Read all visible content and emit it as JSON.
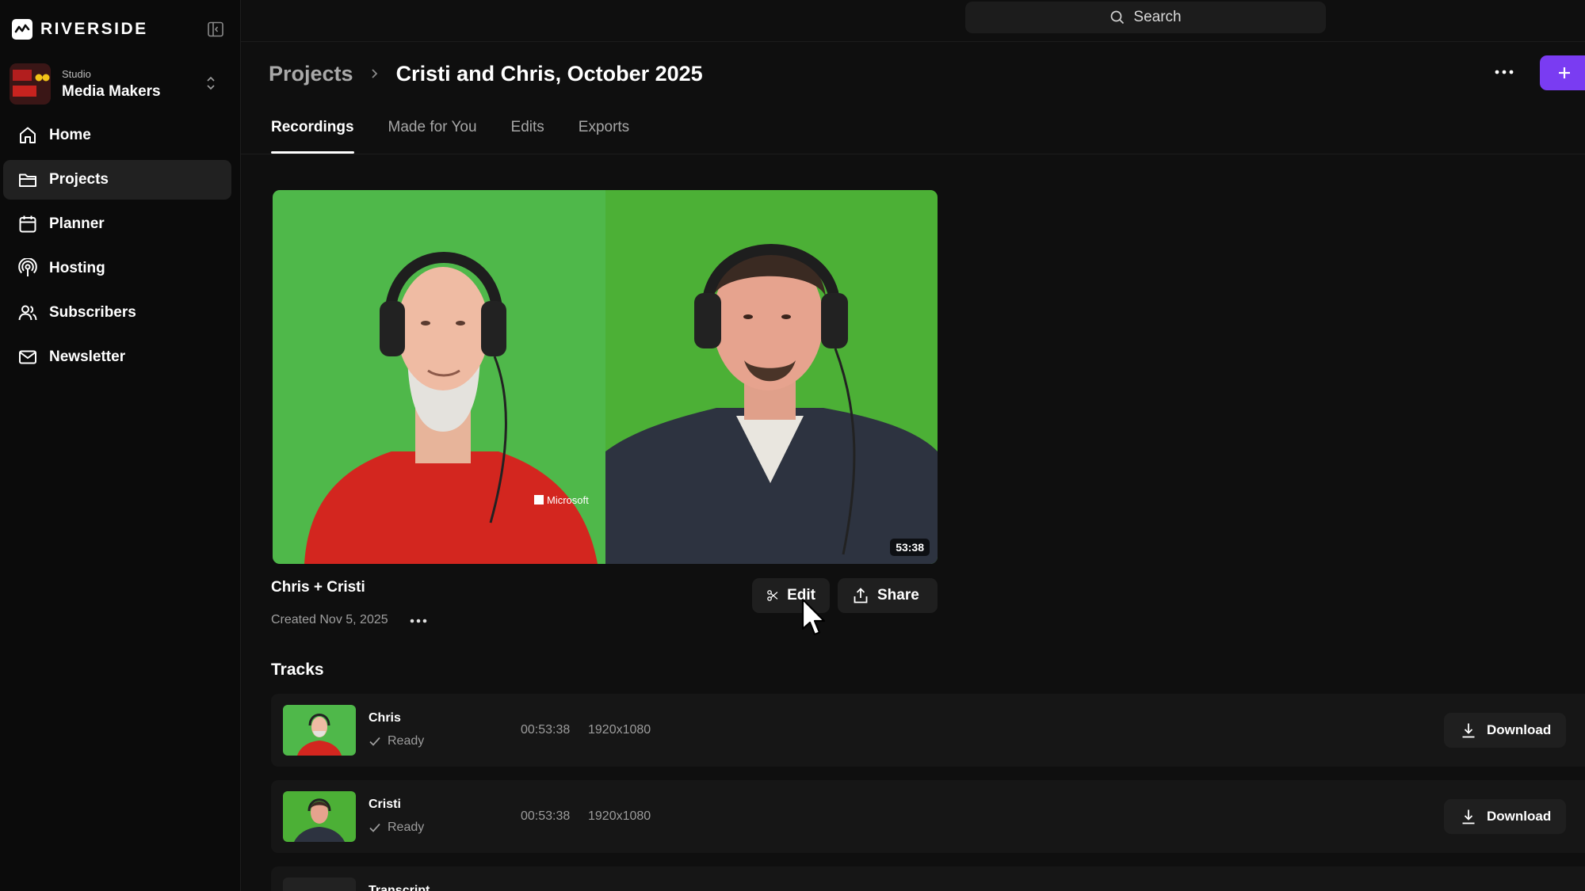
{
  "app": {
    "brand": "RIVERSIDE"
  },
  "sidebar": {
    "studio_label": "Studio",
    "studio_name": "Media Makers",
    "items": [
      {
        "label": "Home",
        "icon": "home-icon",
        "active": false
      },
      {
        "label": "Projects",
        "icon": "folder-icon",
        "active": true
      },
      {
        "label": "Planner",
        "icon": "calendar-icon",
        "active": false
      },
      {
        "label": "Hosting",
        "icon": "podcast-icon",
        "active": false
      },
      {
        "label": "Subscribers",
        "icon": "users-icon",
        "active": false
      },
      {
        "label": "Newsletter",
        "icon": "mail-icon",
        "active": false
      }
    ]
  },
  "search": {
    "placeholder": "Search"
  },
  "header": {
    "breadcrumb_root": "Projects",
    "title": "Cristi and Chris, October 2025"
  },
  "tabs": [
    {
      "label": "Recordings",
      "active": true
    },
    {
      "label": "Made for You",
      "active": false
    },
    {
      "label": "Edits",
      "active": false
    },
    {
      "label": "Exports",
      "active": false
    }
  ],
  "recording": {
    "duration": "53:38",
    "title": "Chris + Cristi",
    "created": "Created Nov 5, 2025",
    "edit_label": "Edit",
    "share_label": "Share",
    "shirt_logo": "Microsoft"
  },
  "tracks_heading": "Tracks",
  "tracks": [
    {
      "name": "Chris",
      "status": "Ready",
      "duration": "00:53:38",
      "resolution": "1920x1080",
      "download_label": "Download"
    },
    {
      "name": "Cristi",
      "status": "Ready",
      "duration": "00:53:38",
      "resolution": "1920x1080",
      "download_label": "Download"
    }
  ],
  "partial_track": {
    "name": "Transcript"
  },
  "colors": {
    "accent": "#7a3cf2",
    "background": "#0f0f0f",
    "sidebar": "#0b0b0b",
    "green_screen": "#4fb84a",
    "shirt_red": "#d3261f"
  }
}
